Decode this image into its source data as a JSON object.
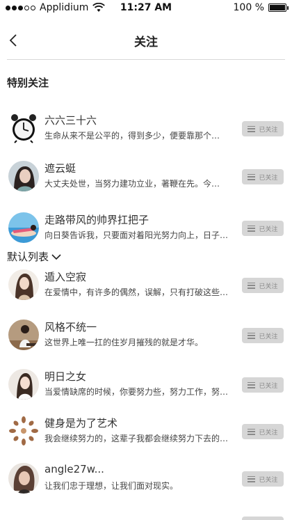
{
  "status_bar": {
    "carrier": "Applidium",
    "time": "11:27 AM",
    "battery": "100 %",
    "signal_bars_filled": 3,
    "signal_bars_total": 5
  },
  "nav": {
    "title": "关注",
    "back_icon": "chevron-left-icon"
  },
  "sections": {
    "special_title": "特别关注",
    "default_title": "默认列表",
    "default_icon": "chevron-down-icon"
  },
  "follow_button_label": "已关注",
  "special_users": [
    {
      "name": "六六三十六",
      "bio": "生命从来不是公平的，得到多少，便要靠那个…",
      "avatar": "alarm-clock"
    },
    {
      "name": "遮云蜓",
      "bio": "大丈夫处世，当努力建功立业，著鞭在先。今…",
      "avatar": "portrait-dark-hair"
    },
    {
      "name": "走路带风的帅界扛把子",
      "bio": "向日葵告诉我，只要面对着阳光努力向上，日子…",
      "avatar": "beach-scene"
    }
  ],
  "default_users": [
    {
      "name": "遁入空寂",
      "bio": "在爱情中，有许多的偶然，误解，只有打破这些…",
      "avatar": "portrait-long-hair"
    },
    {
      "name": "风格不统一",
      "bio": "这世界上唯一扛的住岁月摧残的就是才华。",
      "avatar": "seated-figure"
    },
    {
      "name": "明日之女",
      "bio": "当爱情缺席的时候，你要努力些，努力工作，努…",
      "avatar": "portrait-light"
    },
    {
      "name": "健身是为了艺术",
      "bio": "我会继续努力的，这辈子我都会继续努力下去的…",
      "avatar": "floral-ornament"
    },
    {
      "name": "angle27w...",
      "bio": "让我们忠于理想，让我们面对现实。",
      "avatar": "portrait-curly"
    }
  ],
  "colors": {
    "follow_button_bg": "#d6d6d6",
    "follow_button_text": "#8a8a8a",
    "divider": "#d8d8d8"
  }
}
